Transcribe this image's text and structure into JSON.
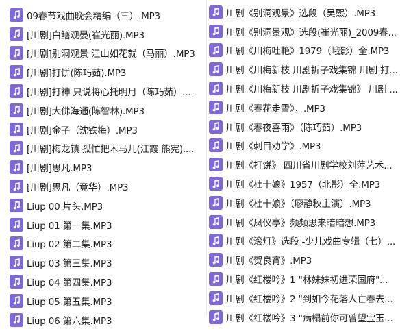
{
  "colors": {
    "icon_bg": "#7f68d8",
    "icon_fg": "#ffffff"
  },
  "icon": "music-note-icon",
  "left_files": [
    "09春节戏曲晚会精编（三）.MP3",
    "[川剧]白鳝观晏(崔光丽).MP3",
    "[川剧]别洞观景 江山如花就（马丽）.MP3",
    "[川剧]打饼(陈巧茹).MP3",
    "[川剧]打神 只说将心托明月（陈巧茹）....",
    "[川剧]大佛海通(陈智林).MP3",
    "[川剧]金子（沈铁梅）.MP3",
    "[川剧]梅龙镇 孤忙把木马儿(江霞 熊宪)....",
    "[川剧]思凡.MP3",
    "[川剧]思凡（竟华）.MP3",
    "Liup 00 片头.MP3",
    "Liup 01 第一集.MP3",
    "Liup 02 第二集.MP3",
    "Liup 03 第三集.MP3",
    "Liup 04 第四集.MP3",
    "Liup 05 第五集.MP3",
    "Liup 06 第六集.MP3"
  ],
  "right_files": [
    "川剧《别洞观景》选段（吴熙）.MP3",
    "川剧《别洞景观》选段(崔光丽)_2009春...",
    "川剧《川梅吐艳》1979（峨影）全.MP3",
    "川剧《川梅新枝 川剧折子戏集锦 川剧 打...",
    "川剧《川梅新枝 川剧折子戏集锦》 川剧 ...",
    "川剧《春花走雪》，.MP3",
    "川剧《春夜喜雨》（陈巧茹）.MP3",
    "川剧《刺目劝学》.MP3",
    "川剧《打饼》 四川省川剧学校刘萍艺术...",
    "川剧《杜十娘》1957（北影）全.MP3",
    "川剧《杜十娘》（廖静秋主演）.MP3",
    "川剧《凤仪亭》频频思来暗暗想.MP3",
    "川剧《滚灯》选段 -少儿戏曲专辑（七）...",
    "川剧《贺良宵》.MP3",
    "川剧《红楼吟》1 \"林妹妹初进荣国府\"...",
    "川剧《红楼吟》2 \"到如今花落人亡春去...",
    "川剧《红楼吟》3 \"病榻前你可曾望宝玉..."
  ]
}
